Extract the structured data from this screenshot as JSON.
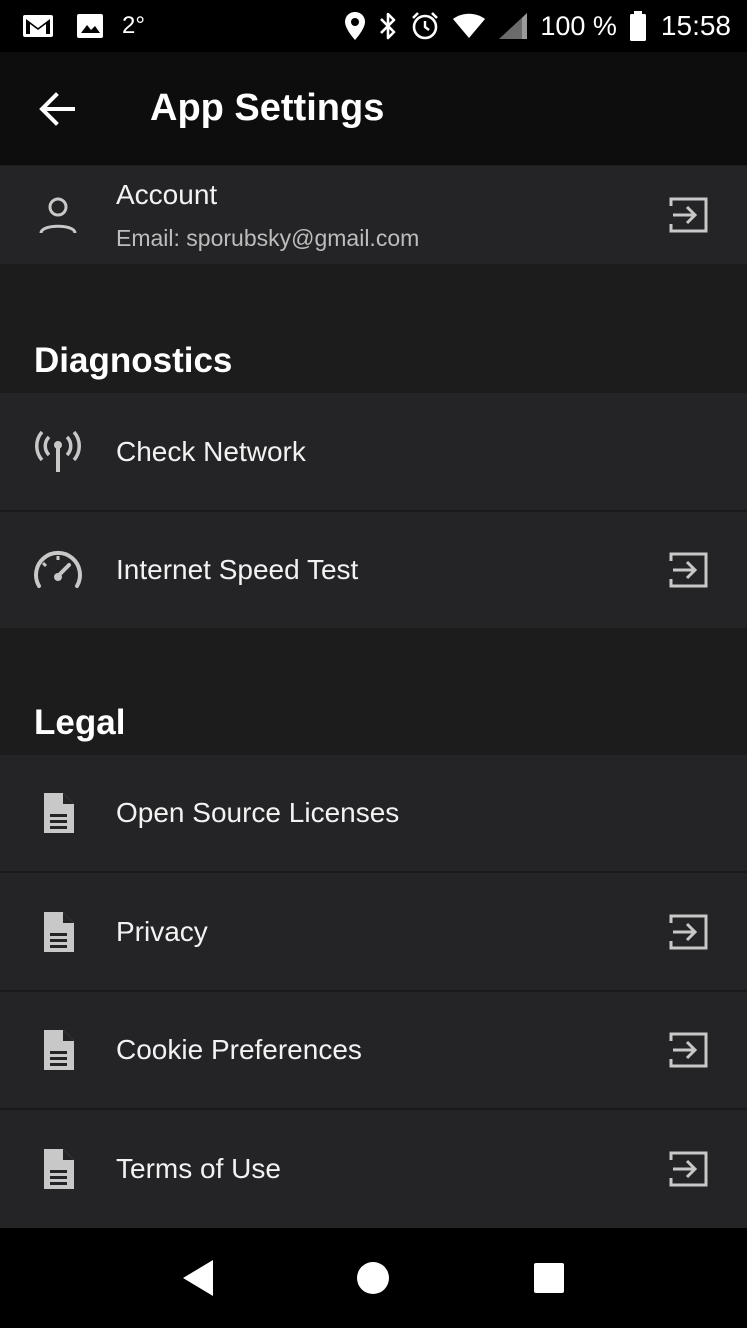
{
  "status_bar": {
    "temperature": "2°",
    "battery_percent": "100 %",
    "time": "15:58",
    "left_icons": [
      "gmail-icon",
      "image-icon"
    ],
    "right_icons": [
      "location-icon",
      "bluetooth-icon",
      "alarm-icon",
      "wifi-icon",
      "signal-icon",
      "battery-icon"
    ]
  },
  "app_bar": {
    "title": "App Settings",
    "back_icon": "arrow-back-icon"
  },
  "account": {
    "title": "Account",
    "email": "Email: sporubsky@gmail.com",
    "icon": "person-icon",
    "action_icon": "exit-to-app-icon"
  },
  "sections": {
    "diagnostics": {
      "header": "Diagnostics",
      "items": [
        {
          "label": "Check Network",
          "icon": "antenna-icon"
        },
        {
          "label": "Internet Speed Test",
          "icon": "speedometer-icon",
          "action_icon": "exit-to-app-icon"
        }
      ]
    },
    "legal": {
      "header": "Legal",
      "items": [
        {
          "label": "Open Source Licenses",
          "icon": "document-icon"
        },
        {
          "label": "Privacy",
          "icon": "document-icon",
          "action_icon": "exit-to-app-icon"
        },
        {
          "label": "Cookie Preferences",
          "icon": "document-icon",
          "action_icon": "exit-to-app-icon"
        },
        {
          "label": "Terms of Use",
          "icon": "document-icon",
          "action_icon": "exit-to-app-icon"
        }
      ]
    }
  },
  "nav_bar": {
    "icons": [
      "nav-back-icon",
      "nav-home-icon",
      "nav-recents-icon"
    ]
  },
  "colors": {
    "background": "#1c1c1d",
    "row": "#242325",
    "app_bar": "#0d0d0d",
    "status_bar": "#000000",
    "text": "#ffffff",
    "subtext": "#bdbdbd",
    "icon": "#c8c8c8"
  }
}
